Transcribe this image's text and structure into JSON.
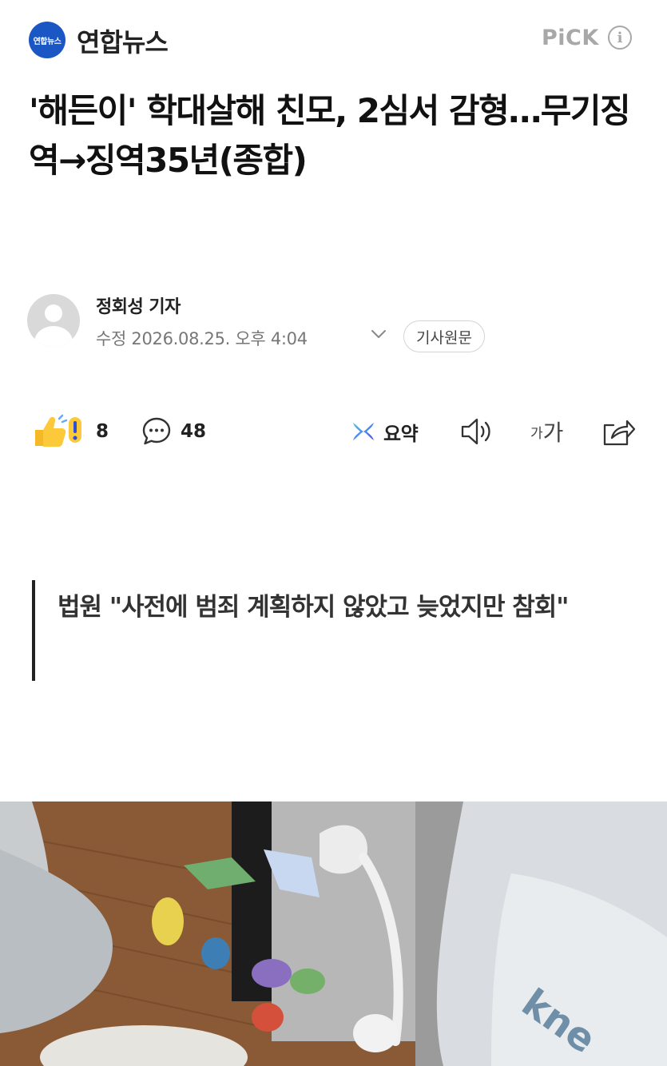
{
  "header": {
    "logo_text": "연합뉴스",
    "press_name": "연합뉴스",
    "pick_label": "PiCK",
    "info_glyph": "i"
  },
  "article": {
    "title": "'해든이' 학대살해 친모, 2심서 감형…무기징역→징역35년(종합)",
    "reporter": "정회성 기자",
    "dateline": "수정 2026.08.25. 오후 4:04",
    "origin_button": "기사원문",
    "subtitle": "법원 \"사전에 범죄 계획하지 않았고 늦었지만 참회\""
  },
  "toolbar": {
    "reaction_count": "8",
    "comment_count": "48",
    "summary_label": "요약",
    "font_small": "가",
    "font_large": "가"
  },
  "colors": {
    "logo_blue": "#1a57c5",
    "pick_gray": "#a8a8a8",
    "text_dark": "#111111",
    "text_meta": "#777777"
  },
  "icons": [
    "info-icon",
    "avatar-icon",
    "chevron-down-icon",
    "reaction-thumbs-icon",
    "comment-bubble-icon",
    "summary-ai-icon",
    "speaker-icon",
    "share-icon"
  ]
}
